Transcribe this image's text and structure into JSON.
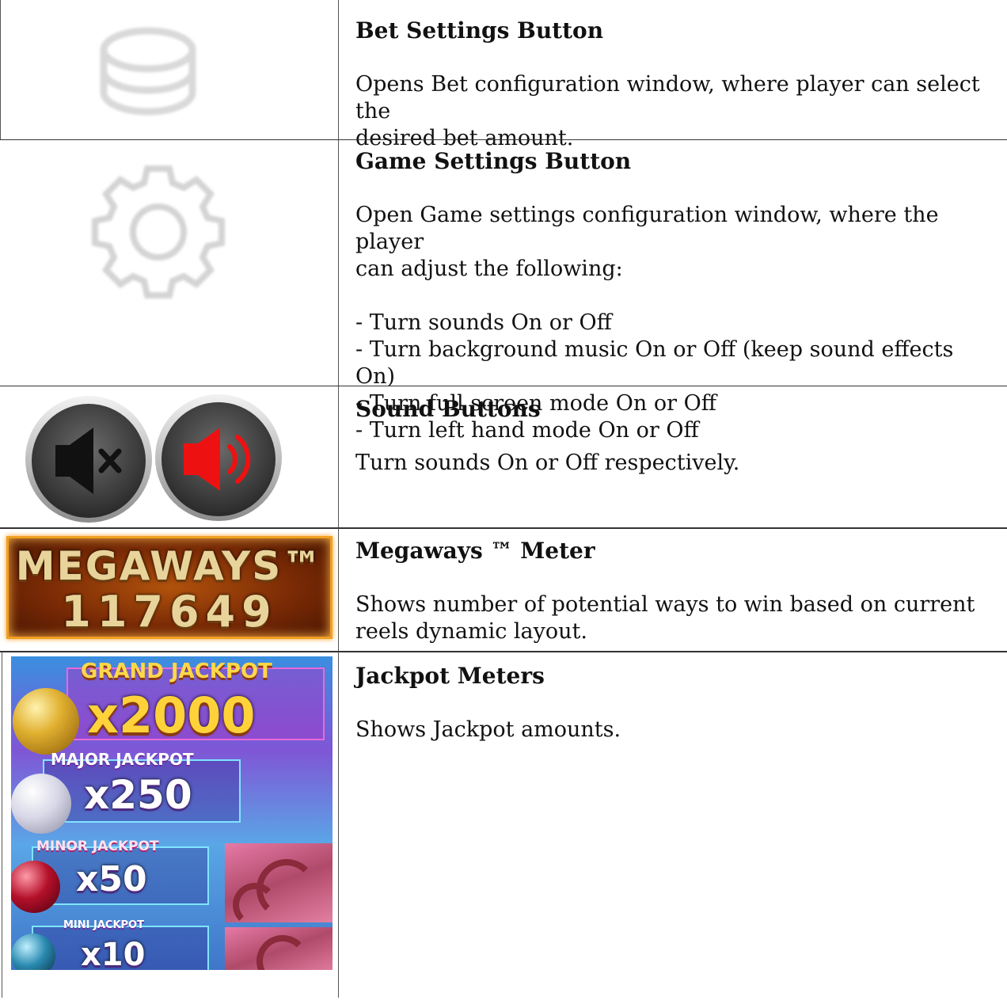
{
  "rows": [
    {
      "title": "Bet Settings Button",
      "description": "Opens Bet configuration window, where player can select the\ndesired bet amount.",
      "icon": "coin-stack-icon"
    },
    {
      "title": "Game Settings Button",
      "description": "Open Game settings configuration window, where the player\ncan adjust the following:",
      "items": [
        "- Turn sounds On or Off",
        "- Turn background music On or Off (keep sound effects On)",
        "- Turn full screen mode On or Off",
        "- Turn left hand mode On or Off"
      ],
      "icon": "gear-icon"
    },
    {
      "title": "Sound Buttons",
      "description": "Turn sounds On or Off respectively.",
      "icons": [
        "mute-icon",
        "speaker-icon"
      ],
      "colors": {
        "mute_glyph": "#111111",
        "speaker_glyph": "#ee1111"
      }
    },
    {
      "title": "Megaways ™ Meter",
      "description": "Shows number of potential ways to win based on current\nreels dynamic layout.",
      "meter": {
        "label": "MEGAWAYS™",
        "value": "117649"
      }
    },
    {
      "title": "Jackpot Meters",
      "description": "Shows Jackpot amounts.",
      "jackpots": [
        {
          "label": "GRAND JACKPOT",
          "value": "x2000"
        },
        {
          "label": "MAJOR JACKPOT",
          "value": "x250"
        },
        {
          "label": "MINOR JACKPOT",
          "value": "x50"
        },
        {
          "label": "MINI JACKPOT",
          "value": "x10"
        }
      ]
    }
  ]
}
